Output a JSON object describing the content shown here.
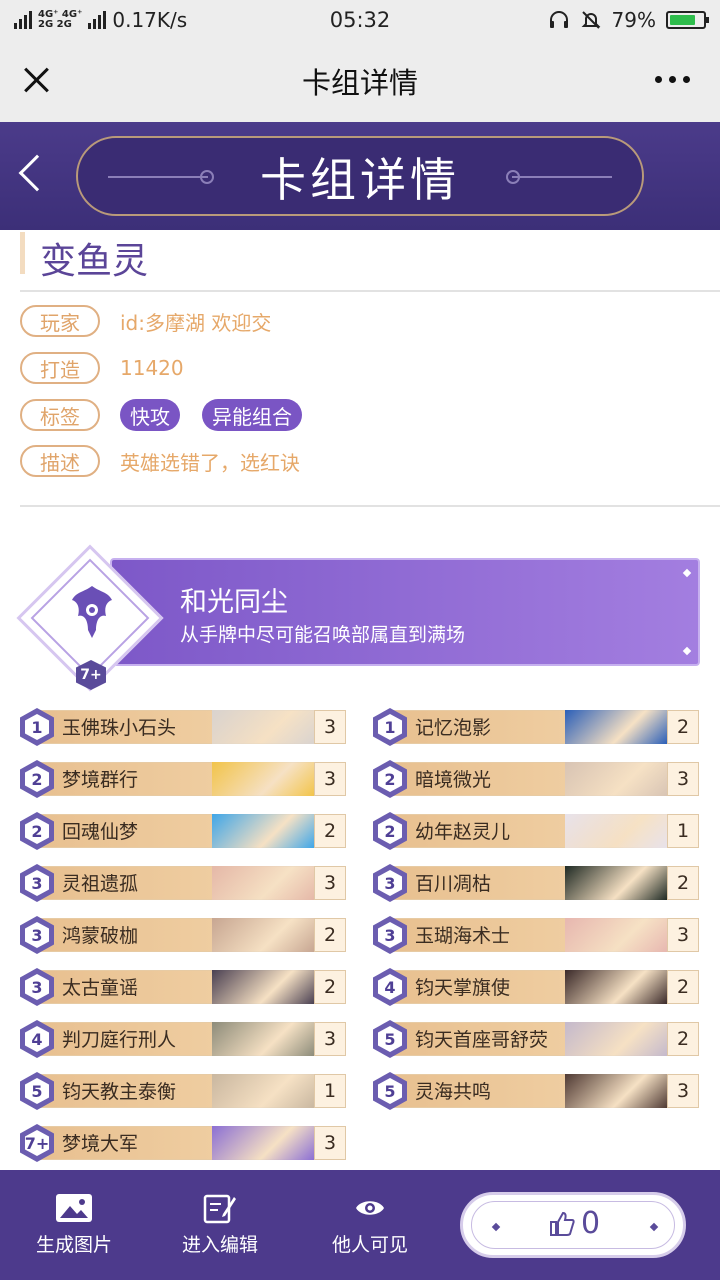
{
  "status_bar": {
    "network_top": "4G⁺ 4G⁺",
    "network_bottom": "2G   2G",
    "speed": "0.17K/s",
    "time": "05:32",
    "battery": "79%"
  },
  "wechat_header": {
    "title": "卡组详情"
  },
  "banner": {
    "title": "卡组详情"
  },
  "deck": {
    "name": "变鱼灵",
    "player_label": "玩家",
    "player_value": "id:多摩湖 欢迎交",
    "craft_label": "打造",
    "craft_value": "11420",
    "tags_label": "标签",
    "tags": [
      "快攻",
      "异能组合"
    ],
    "desc_label": "描述",
    "desc_value": "英雄选错了，选红诀"
  },
  "leader": {
    "title": "和光同尘",
    "description": "从手牌中尽可能召唤部属直到满场",
    "cost": "7+"
  },
  "cards_left": [
    {
      "cost": "1",
      "name": "玉佛珠小石头",
      "count": "3"
    },
    {
      "cost": "2",
      "name": "梦境群行",
      "count": "3"
    },
    {
      "cost": "2",
      "name": "回魂仙梦",
      "count": "2"
    },
    {
      "cost": "3",
      "name": "灵祖遗孤",
      "count": "3"
    },
    {
      "cost": "3",
      "name": "鸿蒙破枷",
      "count": "2"
    },
    {
      "cost": "3",
      "name": "太古童谣",
      "count": "2"
    },
    {
      "cost": "4",
      "name": "判刀庭行刑人",
      "count": "3"
    },
    {
      "cost": "5",
      "name": "钧天教主泰衡",
      "count": "1"
    },
    {
      "cost": "7+",
      "name": "梦境大军",
      "count": "3"
    }
  ],
  "cards_right": [
    {
      "cost": "1",
      "name": "记忆泡影",
      "count": "2"
    },
    {
      "cost": "2",
      "name": "暗境微光",
      "count": "3"
    },
    {
      "cost": "2",
      "name": "幼年赵灵儿",
      "count": "1"
    },
    {
      "cost": "3",
      "name": "百川凋枯",
      "count": "2"
    },
    {
      "cost": "3",
      "name": "玉瑚海术士",
      "count": "3"
    },
    {
      "cost": "4",
      "name": "钧天掌旗使",
      "count": "2"
    },
    {
      "cost": "5",
      "name": "钧天首座哥舒荧",
      "count": "2"
    },
    {
      "cost": "5",
      "name": "灵海共鸣",
      "count": "3"
    }
  ],
  "card_art_colors_left": [
    "#d9d3cf",
    "#f2c44a",
    "#3fa6e8",
    "#e5b8a8",
    "#c7a692",
    "#4a4052",
    "#8d8c7a",
    "#c9b7a0",
    "#8b6fd4"
  ],
  "card_art_colors_right": [
    "#2b5fb8",
    "#d8c4b4",
    "#e8e2ea",
    "#1f2a24",
    "#e7b7b0",
    "#3b2a2a",
    "#c4b9cc",
    "#4f3a34"
  ],
  "bottom_bar": {
    "generate_image": "生成图片",
    "enter_edit": "进入编辑",
    "visible_to_others": "他人可见",
    "like_count": "0"
  },
  "colors": {
    "brand_purple": "#4d3a8c",
    "accent_orange": "#e0a46a",
    "tag_purple": "#7a55c4"
  },
  "icons": [
    "close-icon",
    "more-icon",
    "back-arrow-icon",
    "image-icon",
    "edit-icon",
    "eye-icon",
    "thumbs-up-icon"
  ]
}
